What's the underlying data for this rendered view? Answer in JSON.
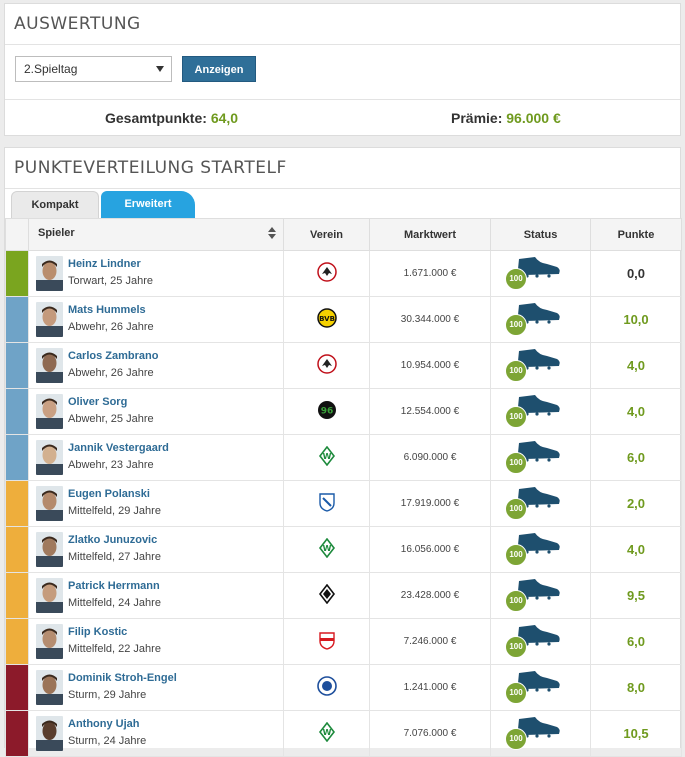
{
  "auswertung": {
    "title": "AUSWERTUNG",
    "select_value": "2.Spieltag",
    "button_label": "Anzeigen",
    "gesamt_label": "Gesamtpunkte:",
    "gesamt_value": "64,0",
    "praemie_label": "Prämie:",
    "praemie_value": "96.000 €"
  },
  "startelf": {
    "title": "PUNKTEVERTEILUNG STARTELF",
    "tabs": [
      {
        "label": "Kompakt",
        "active": false
      },
      {
        "label": "Erweitert",
        "active": true
      }
    ],
    "columns": {
      "spieler": "Spieler",
      "verein": "Verein",
      "marktwert": "Marktwert",
      "status": "Status",
      "punkte": "Punkte"
    },
    "status_badge": "100",
    "colors": {
      "torwart": "#7aa51f",
      "abwehr": "#6fa3c7",
      "mittelfeld": "#eeae3c",
      "sturm": "#8c1a2a",
      "accent": "#27a3e0",
      "points": "#6f9a1e",
      "boot": "#1e4f6e"
    },
    "players": [
      {
        "name": "Heinz Lindner",
        "detail": "Torwart, 25 Jahre",
        "pos": "torwart",
        "club_icon": "eintracht-frankfurt-icon",
        "marktwert": "1.671.000 €",
        "punkte": "0,0"
      },
      {
        "name": "Mats Hummels",
        "detail": "Abwehr, 26 Jahre",
        "pos": "abwehr",
        "club_icon": "borussia-dortmund-icon",
        "marktwert": "30.344.000 €",
        "punkte": "10,0"
      },
      {
        "name": "Carlos Zambrano",
        "detail": "Abwehr, 26 Jahre",
        "pos": "abwehr",
        "club_icon": "eintracht-frankfurt-icon",
        "marktwert": "10.954.000 €",
        "punkte": "4,0"
      },
      {
        "name": "Oliver Sorg",
        "detail": "Abwehr, 25 Jahre",
        "pos": "abwehr",
        "club_icon": "hannover-96-icon",
        "marktwert": "12.554.000 €",
        "punkte": "4,0"
      },
      {
        "name": "Jannik Vestergaard",
        "detail": "Abwehr, 23 Jahre",
        "pos": "abwehr",
        "club_icon": "werder-bremen-icon",
        "marktwert": "6.090.000 €",
        "punkte": "6,0"
      },
      {
        "name": "Eugen Polanski",
        "detail": "Mittelfeld, 29 Jahre",
        "pos": "mittelfeld",
        "club_icon": "hoffenheim-icon",
        "marktwert": "17.919.000 €",
        "punkte": "2,0"
      },
      {
        "name": "Zlatko Junuzovic",
        "detail": "Mittelfeld, 27 Jahre",
        "pos": "mittelfeld",
        "club_icon": "werder-bremen-icon",
        "marktwert": "16.056.000 €",
        "punkte": "4,0"
      },
      {
        "name": "Patrick Herrmann",
        "detail": "Mittelfeld, 24 Jahre",
        "pos": "mittelfeld",
        "club_icon": "gladbach-icon",
        "marktwert": "23.428.000 €",
        "punkte": "9,5"
      },
      {
        "name": "Filip Kostic",
        "detail": "Mittelfeld, 22 Jahre",
        "pos": "mittelfeld",
        "club_icon": "vfb-stuttgart-icon",
        "marktwert": "7.246.000 €",
        "punkte": "6,0"
      },
      {
        "name": "Dominik Stroh-Engel",
        "detail": "Sturm, 29 Jahre",
        "pos": "sturm",
        "club_icon": "darmstadt-icon",
        "marktwert": "1.241.000 €",
        "punkte": "8,0"
      },
      {
        "name": "Anthony Ujah",
        "detail": "Sturm, 24 Jahre",
        "pos": "sturm",
        "club_icon": "werder-bremen-icon",
        "marktwert": "7.076.000 €",
        "punkte": "10,5"
      }
    ]
  }
}
